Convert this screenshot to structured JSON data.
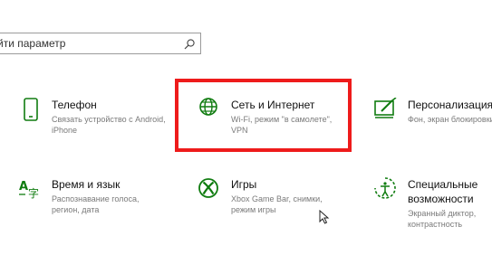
{
  "search": {
    "placeholder": "йти параметр"
  },
  "tiles": [
    {
      "title": "Телефон",
      "desc_line1": "Связать устройство с Android,",
      "desc_line2": "iPhone",
      "icon": "phone-icon"
    },
    {
      "title": "Сеть и Интернет",
      "desc_line1": "Wi-Fi, режим \"в самолете\",",
      "desc_line2": "VPN",
      "icon": "globe-icon"
    },
    {
      "title": "Персонализация",
      "desc_line1": "Фон, экран блокировки",
      "desc_line2": "",
      "icon": "personalization-icon"
    },
    {
      "title": "Время и язык",
      "desc_line1": "Распознавание голоса,",
      "desc_line2": "регион, дата",
      "icon": "time-language-icon"
    },
    {
      "title": "Игры",
      "desc_line1": "Xbox Game Bar, снимки,",
      "desc_line2": "режим игры",
      "icon": "xbox-icon"
    },
    {
      "title_line1": "Специальные",
      "title_line2": "возможности",
      "desc_line1": "Экранный диктор,",
      "desc_line2": "контрастность",
      "icon": "ease-of-access-icon"
    }
  ],
  "colors": {
    "accent": "#107c10",
    "highlight": "#ee1b1b"
  }
}
